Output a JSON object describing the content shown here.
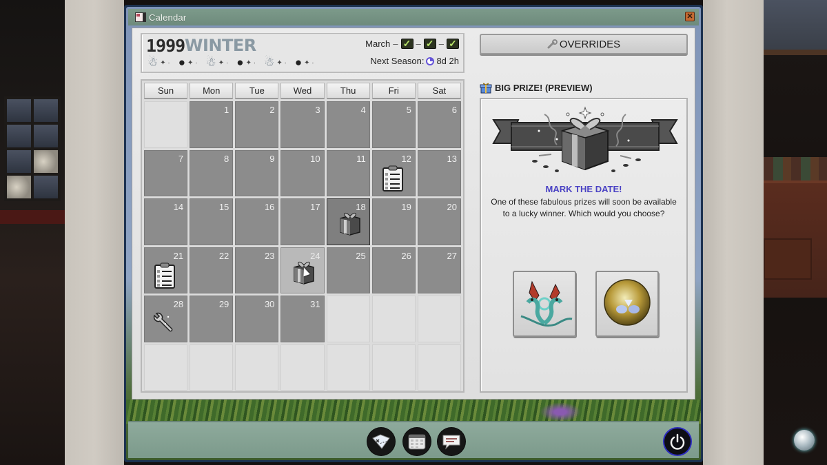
{
  "window": {
    "title": "Calendar",
    "close_label": "✕"
  },
  "season": {
    "year": "1999",
    "name": "WINTER",
    "mascots": [
      "snowman",
      "penguin",
      "snowman",
      "penguin",
      "snowman",
      "penguin"
    ],
    "month_label": "March",
    "month_progress": [
      {
        "state": "checked",
        "glyph": "✓"
      },
      {
        "state": "checked",
        "glyph": "✓"
      },
      {
        "state": "checked",
        "glyph": "✓"
      }
    ],
    "dash": "–",
    "next_season_label": "Next Season:",
    "next_season_value": "8d 2h"
  },
  "calendar": {
    "weekdays": [
      "Sun",
      "Mon",
      "Tue",
      "Wed",
      "Thu",
      "Fri",
      "Sat"
    ],
    "first_weekday_index": 1,
    "days_in_month": 31,
    "today": 18,
    "hovered": 24,
    "events": [
      {
        "day": 12,
        "icon": "clipboard-checklist"
      },
      {
        "day": 18,
        "icon": "gift-box"
      },
      {
        "day": 21,
        "icon": "clipboard-checklist"
      },
      {
        "day": 24,
        "icon": "gift-box"
      },
      {
        "day": 28,
        "icon": "wrench"
      }
    ]
  },
  "overrides": {
    "label": "OVERRIDES",
    "icon": "wrench-icon"
  },
  "prize": {
    "heading": "BIG PRIZE! (PREVIEW)",
    "title": "MARK THE DATE!",
    "description": "One of these fabulous prizes will soon be available to a lucky winner. Which would you choose?",
    "options": [
      {
        "name": "Winged serpent ornament",
        "icon": "dragon-wings-icon"
      },
      {
        "name": "Golden orb",
        "icon": "golden-orb-icon"
      }
    ]
  },
  "taskbar": {
    "apps": [
      {
        "name": "planner",
        "icon": "map-note-icon"
      },
      {
        "name": "calendar",
        "icon": "calendar-icon"
      },
      {
        "name": "chat",
        "icon": "speech-bubble-icon"
      }
    ],
    "power_icon": "power-icon"
  },
  "colors": {
    "accent_title": "#4a42c4",
    "active_day": "#8c8c8c",
    "titlebar": "#7c9a8a",
    "check_green": "#b8e46a",
    "clock_purple": "#6655d8"
  }
}
